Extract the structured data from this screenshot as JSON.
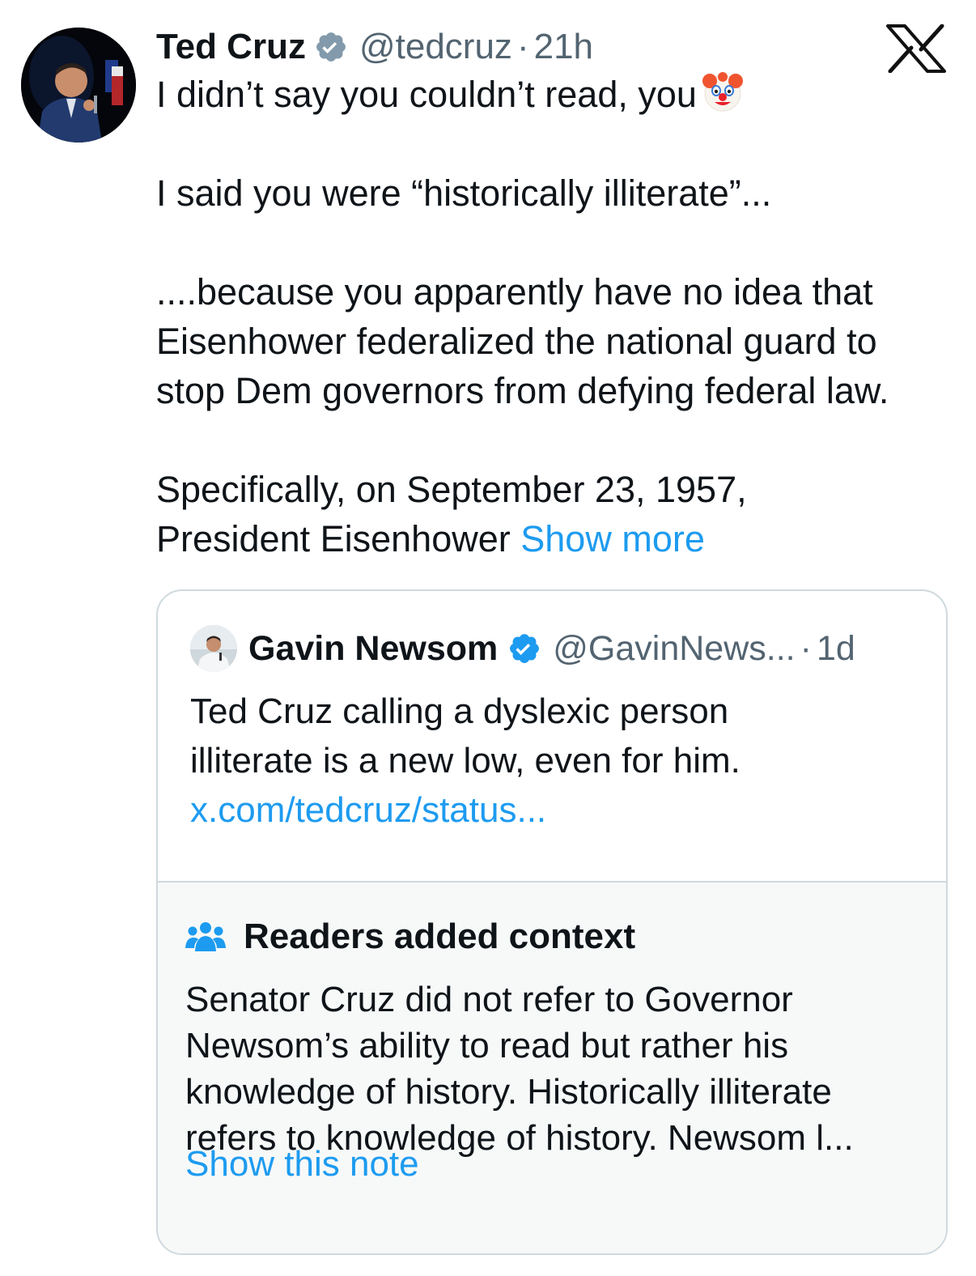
{
  "tweet": {
    "author_name": "Ted Cruz",
    "handle": "@tedcruz",
    "separator": "·",
    "time": "21h",
    "lines": [
      "I didn’t say you couldn’t read, you",
      "",
      "I said you were “historically illiterate”...",
      "",
      "....because you apparently have no idea that",
      "Eisenhower federalized the national guard to",
      "stop Dem governors from defying federal law.",
      "",
      "Specifically, on September 23, 1957,",
      "President Eisenhower"
    ],
    "show_more": "Show more",
    "avatar_icon": "profile-photo",
    "verified_icon": "verified-badge-gray",
    "emoji": "clown-face"
  },
  "platform_logo": "x-logo",
  "quote": {
    "author_name": "Gavin Newsom",
    "handle": "@GavinNews...",
    "separator": "·",
    "time": "1d",
    "verified_icon": "verified-badge-blue",
    "lines": [
      "Ted Cruz calling a dyslexic person",
      "illiterate is a new low, even for him."
    ],
    "link": "x.com/tedcruz/status..."
  },
  "note": {
    "icon": "people-icon",
    "title": "Readers added context",
    "lines": [
      "Senator Cruz did not refer to Governor",
      "Newsom’s ability to read but rather his",
      "knowledge of history. Historically illiterate",
      "refers to knowledge of history. Newsom l..."
    ],
    "link": "Show this note"
  },
  "colors": {
    "text": "#0f1419",
    "secondary": "#536471",
    "link": "#1d9bf0",
    "border": "#cfd9de",
    "note_bg": "#f7f9f9"
  }
}
